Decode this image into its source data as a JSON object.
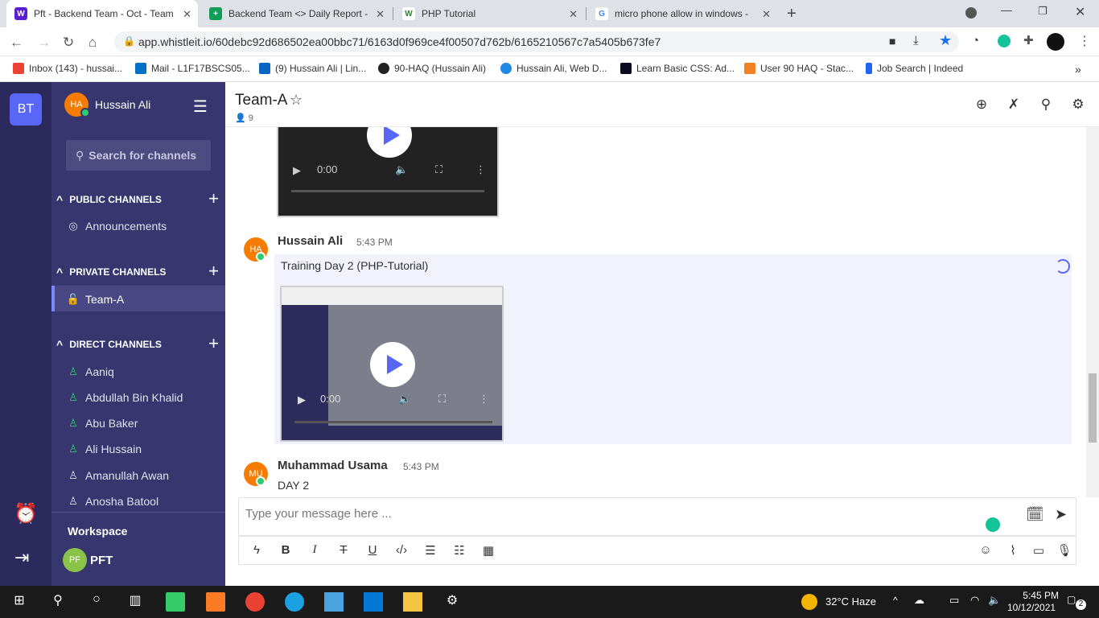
{
  "browser": {
    "tabs": [
      {
        "label": "Pft - Backend Team - Oct - Team",
        "active": true,
        "fav": "W",
        "color": "#5a1fd1"
      },
      {
        "label": "Backend Team <> Daily Report -",
        "fav": "+",
        "color": "#0f9d58"
      },
      {
        "label": "PHP Tutorial",
        "fav": "W",
        "color": "#2e7d32"
      },
      {
        "label": "micro phone allow in windows -",
        "fav": "G",
        "color": "#4285f4"
      }
    ],
    "url": "app.whistleit.io/60debc92d686502ea00bbc71/6163d0f969ce4f00507d762b/6165210567c7a5405b673fe7",
    "bookmarks": [
      "Inbox (143) - hussai...",
      "Mail - L1F17BSCS05...",
      "(9) Hussain Ali | Lin...",
      "90-HAQ (Hussain Ali)",
      "Hussain Ali, Web D...",
      "Learn Basic CSS: Ad...",
      "User 90 HAQ - Stac...",
      "Job Search | Indeed"
    ]
  },
  "rail": {
    "workspace_badge": "BT"
  },
  "sidebar": {
    "user": {
      "initials": "HA",
      "name": "Hussain Ali"
    },
    "search_placeholder": "Search for channels",
    "public_title": "PUBLIC CHANNELS",
    "public_channels": [
      "Announcements"
    ],
    "private_title": "PRIVATE CHANNELS",
    "private_channels": [
      "Team-A"
    ],
    "direct_title": "DIRECT CHANNELS",
    "direct_channels": [
      "Aaniq",
      "Abdullah Bin Khalid",
      "Abu Baker",
      "Ali Hussain",
      "Amanullah Awan",
      "Anosha Batool"
    ],
    "workspace_label": "Workspace",
    "workspace": {
      "initials": "PF",
      "name": "PFT"
    }
  },
  "channel": {
    "title": "Team-A",
    "members": "9"
  },
  "messages": [
    {
      "initials": "HA",
      "author": "Hussain Ali",
      "time": "5:43 PM",
      "text": "Training Day 2 (PHP-Tutorial)",
      "video_time": "0:00"
    },
    {
      "initials": "MU",
      "author": "Muhammad Usama",
      "time": "5:43 PM",
      "text": "DAY 2"
    }
  ],
  "top_video_time": "0:00",
  "composer": {
    "placeholder": "Type your message here ..."
  },
  "taskbar": {
    "weather": "32°C  Haze",
    "time": "5:45 PM",
    "date": "10/12/2021",
    "notif": "2"
  }
}
